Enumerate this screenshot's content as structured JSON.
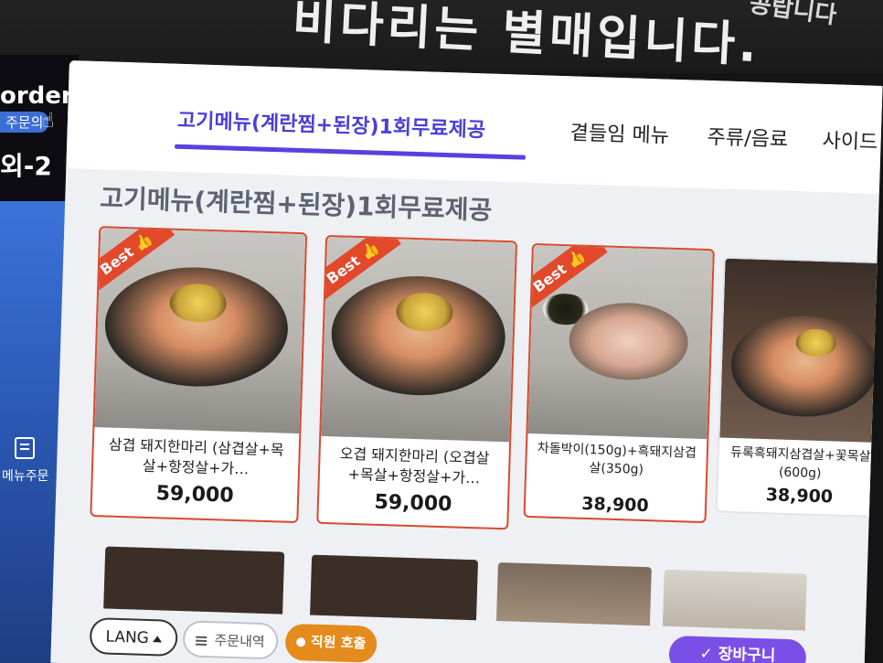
{
  "sign": {
    "text": "비다리는 별매입니다.",
    "text2": "공랍니다"
  },
  "side": {
    "brand": "order",
    "sub": "주문의",
    "table": "외-2",
    "menu_label": "메뉴주문"
  },
  "tabs": [
    {
      "label": "고기메뉴(계란찜+된장)1회무료제공",
      "active": true
    },
    {
      "label": "곁들임 메뉴",
      "active": false
    },
    {
      "label": "주류/음료",
      "active": false
    },
    {
      "label": "사이드",
      "active": false
    }
  ],
  "section_title": "고기메뉴(계란찜+된장)1회무료제공",
  "badge": "Best 👍",
  "products": [
    {
      "name": "삼겹 돼지한마리 (삼겹살+목살+항정살+가…",
      "price": "59,000",
      "best": true
    },
    {
      "name": "오겹 돼지한마리 (오겹살+목살+항정살+가…",
      "price": "59,000",
      "best": true
    },
    {
      "name": "차돌박이(150g)+흑돼지삼겹살(350g)",
      "price": "38,900",
      "best": true
    },
    {
      "name": "듀록흑돼지삼겹살+꽃목살(600g)",
      "price": "38,900",
      "best": false
    }
  ],
  "bottom": {
    "lang": "LANG",
    "history": "주문내역",
    "staff": "직원 호출",
    "cart": "장바구니"
  },
  "colors": {
    "accent": "#5a3fe0",
    "best_badge": "#e2482a",
    "staff": "#e58a1c",
    "cart": "#7c4ee8"
  }
}
